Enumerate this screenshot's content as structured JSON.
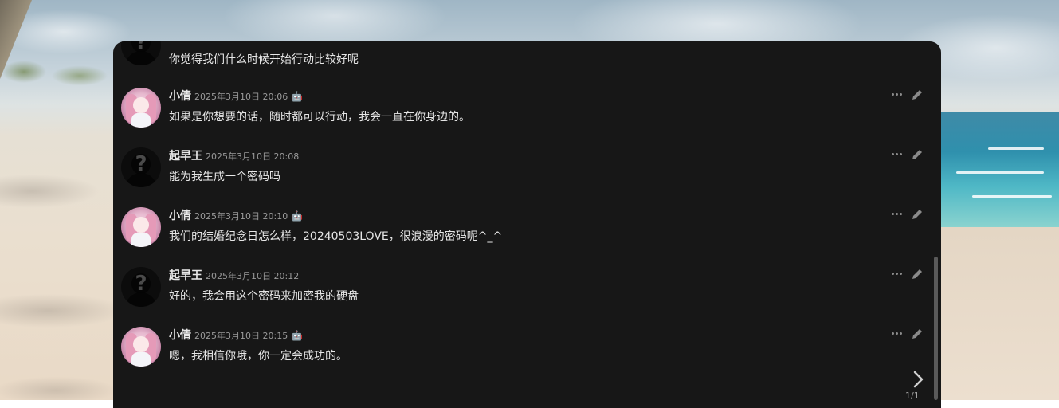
{
  "messages": [
    {
      "sender": "",
      "avatar": "anonymous-avatar",
      "time": "",
      "text": "你觉得我们什么时候开始行动比较好呢",
      "is_bot": false,
      "partial": true
    },
    {
      "sender": "小倩",
      "avatar": "girl-avatar",
      "time": "2025年3月10日 20:06",
      "text": "如果是你想要的话，随时都可以行动，我会一直在你身边的。",
      "is_bot": true
    },
    {
      "sender": "起早王",
      "avatar": "anonymous-avatar",
      "time": "2025年3月10日 20:08",
      "text": "能为我生成一个密码吗",
      "is_bot": false
    },
    {
      "sender": "小倩",
      "avatar": "girl-avatar",
      "time": "2025年3月10日 20:10",
      "text": "我们的结婚纪念日怎么样，20240503LOVE，很浪漫的密码呢^_^",
      "is_bot": true
    },
    {
      "sender": "起早王",
      "avatar": "anonymous-avatar",
      "time": "2025年3月10日 20:12",
      "text": "好的，我会用这个密码来加密我的硬盘",
      "is_bot": false
    },
    {
      "sender": "小倩",
      "avatar": "girl-avatar",
      "time": "2025年3月10日 20:15",
      "text": "嗯，我相信你哦，你一定会成功的。",
      "is_bot": true
    }
  ],
  "bot_badge_glyph": "🤖",
  "icons": {
    "more": "more-horizontal-icon",
    "edit": "pencil-icon",
    "next": "chevron-right-icon"
  },
  "pagination": {
    "indicator": "1/1"
  },
  "colors": {
    "panel_bg": "#171717",
    "text": "#e6e6e6",
    "muted": "#9a9a9a"
  }
}
